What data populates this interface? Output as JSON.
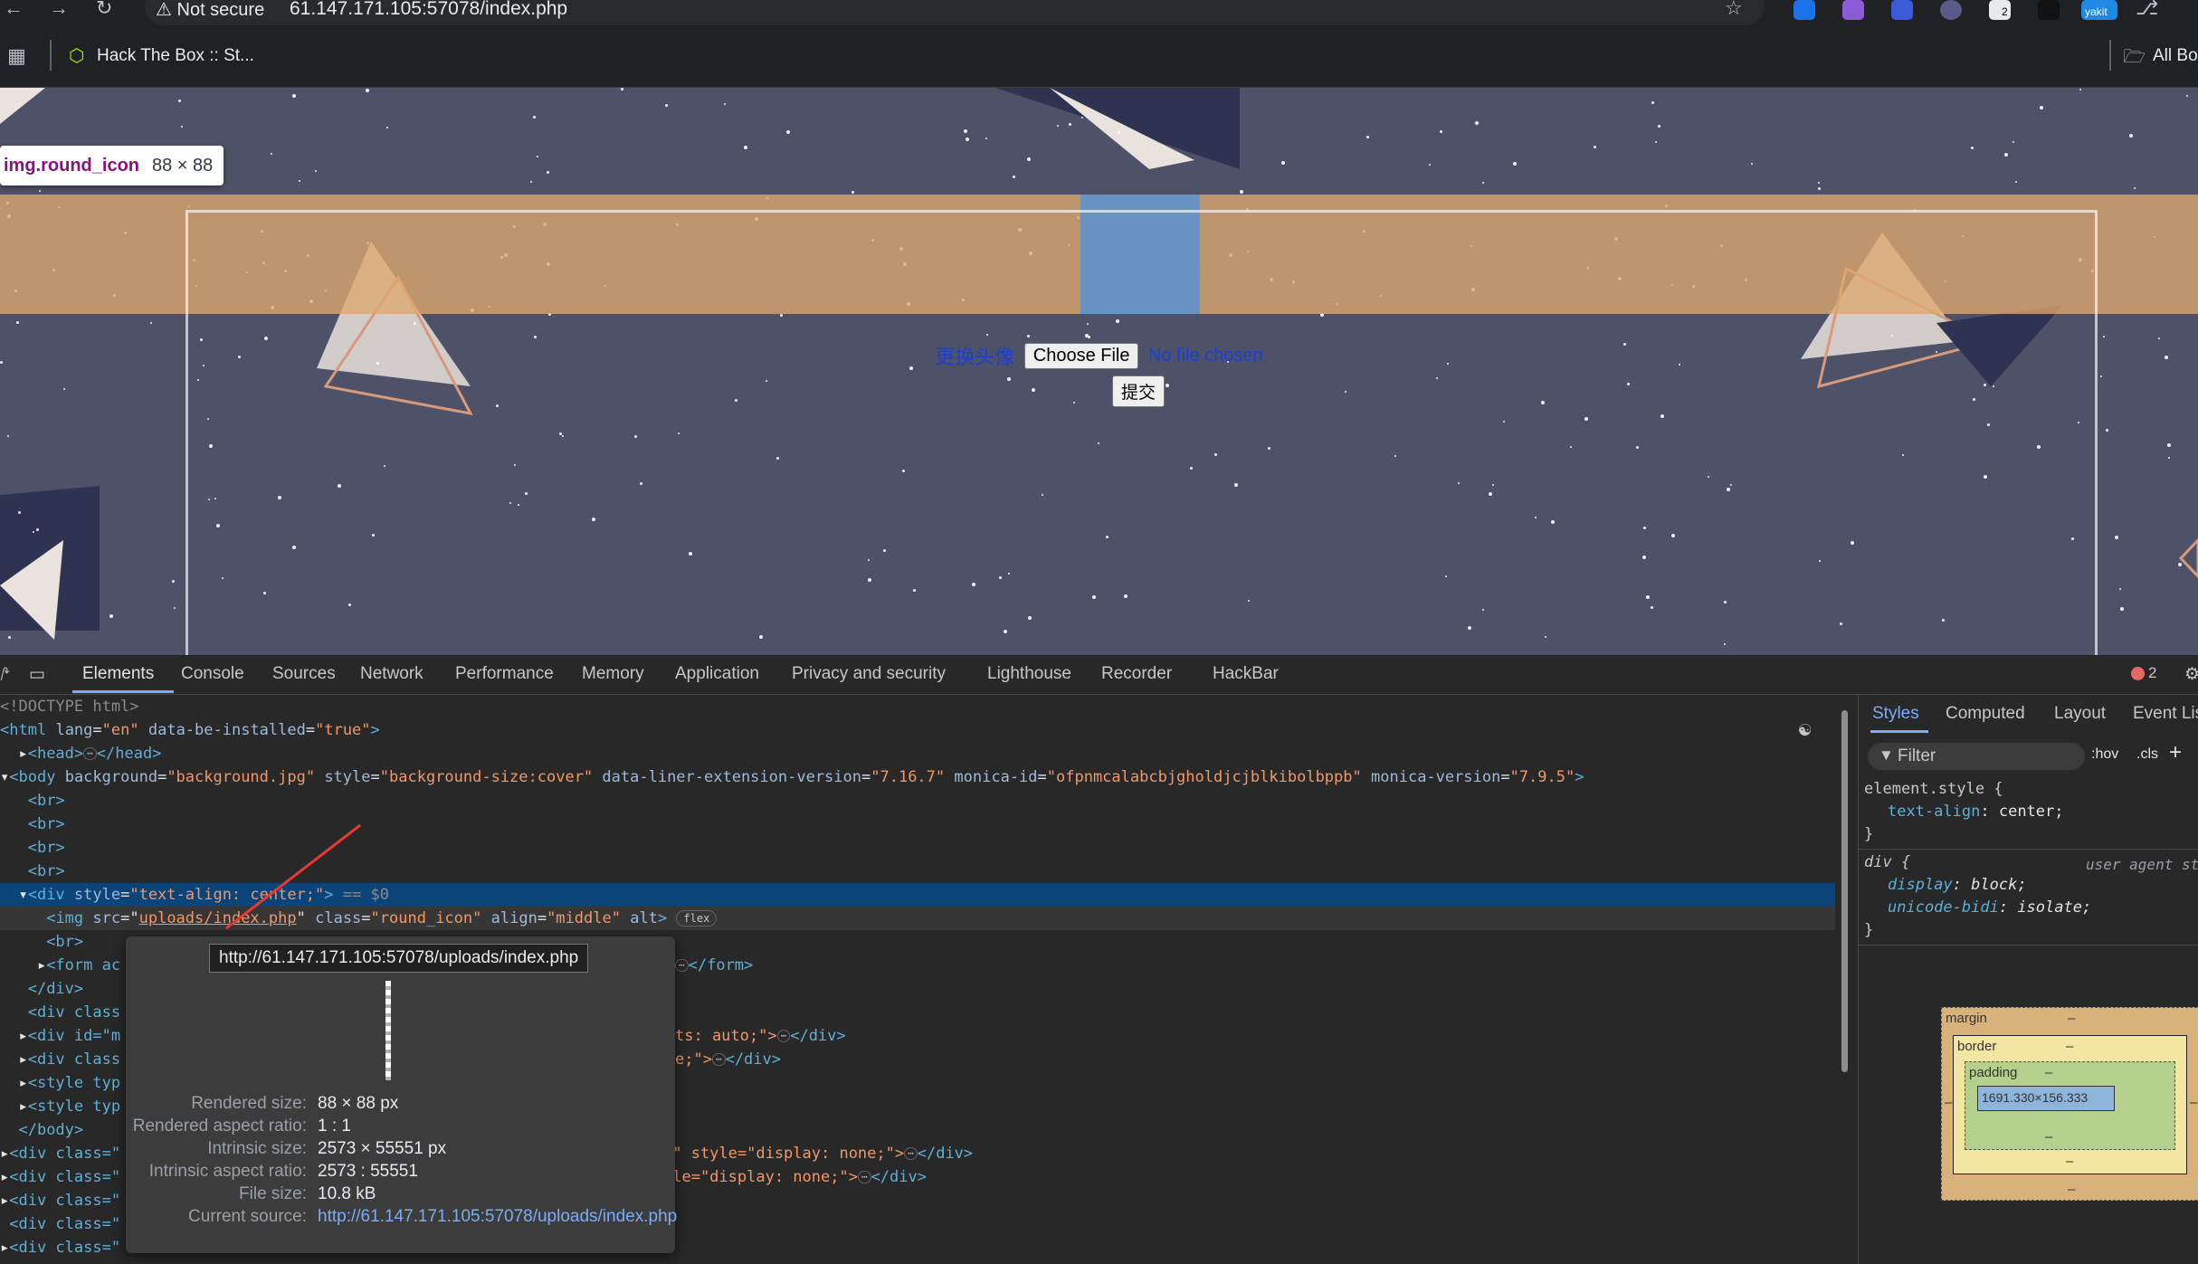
{
  "browser": {
    "security_label": "Not secure",
    "url": "61.147.171.105:57078/index.php",
    "bookmark_label": "Hack The Box :: St...",
    "all_bookmarks_label": "All Bookmarks",
    "extension_badge": "2",
    "extension_label": "yakit"
  },
  "page": {
    "tooltip_selector": "img.round_icon",
    "tooltip_size": "88 × 88",
    "upload_label": "更换头像",
    "choose_file": "Choose File",
    "no_file": "No file chosen",
    "submit": "提交",
    "background_color": "#4d5268"
  },
  "devtools": {
    "tabs": [
      "Elements",
      "Console",
      "Sources",
      "Network",
      "Performance",
      "Memory",
      "Application",
      "Privacy and security",
      "Lighthouse",
      "Recorder",
      "HackBar"
    ],
    "error_count": "2",
    "dom": {
      "doctype": "<!DOCTYPE html>",
      "html_tag": "html",
      "html_attr_lang": "lang",
      "html_val_lang": "\"en\"",
      "html_attr_installed": "data-be-installed",
      "html_val_installed": "\"true\"",
      "head_open": "<head>",
      "head_close": "</head>",
      "body_tag": "body",
      "body_attr_bg": "background",
      "body_val_bg": "\"background.jpg\"",
      "body_attr_style": "style",
      "body_val_style": "\"background-size:cover\"",
      "body_attr_liner": "data-liner-extension-version",
      "body_val_liner": "\"7.16.7\"",
      "body_attr_monica": "monica-id",
      "body_val_monica": "\"ofpnmcalabcbjgholdjcjblkibolbppb\"",
      "body_attr_mver": "monica-version",
      "body_val_mver": "\"7.9.5\"",
      "br": "<br>",
      "div_style_attr": "style",
      "div_style_val": "\"text-align: center;\"",
      "eq_dollar": "== $0",
      "img_tag": "img",
      "img_attr_src": "src",
      "img_val_src": "uploads/index.php",
      "img_attr_class": "class",
      "img_val_class": "\"round_icon\"",
      "img_attr_align": "align",
      "img_val_align": "\"middle\"",
      "img_attr_alt": "alt",
      "flex_badge": "flex",
      "form_partial": "<form ac",
      "form_close": "</form>",
      "div_close": "</div>",
      "div_class_partial": "<div class",
      "div_id_partial": "<div id=\"m",
      "div_class_partial2": "<div class",
      "style_partial": "<style typ",
      "body_close": "</body>",
      "div_class_full_partial": "<div class=\"",
      "auto_tail": "ts: auto;\">",
      "e_tail": "e;\">",
      "p_tail": "p\" style=\"display: none;\">",
      "yle_tail": "yle=\"display: none;\">"
    },
    "image_popup": {
      "url": "http://61.147.171.105:57078/uploads/index.php",
      "rendered_size_label": "Rendered size:",
      "rendered_size": "88 × 88 px",
      "rendered_ratio_label": "Rendered aspect ratio:",
      "rendered_ratio": "1 : 1",
      "intrinsic_size_label": "Intrinsic size:",
      "intrinsic_size": "2573 × 55551 px",
      "intrinsic_ratio_label": "Intrinsic aspect ratio:",
      "intrinsic_ratio": "2573 : 55551",
      "file_size_label": "File size:",
      "file_size": "10.8 kB",
      "current_source_label": "Current source:",
      "current_source": "http://61.147.171.105:57078/uploads/index.php"
    },
    "styles": {
      "tabs": [
        "Styles",
        "Computed",
        "Layout",
        "Event Listeners"
      ],
      "filter_placeholder": "Filter",
      "hov": ":hov",
      "cls": ".cls",
      "element_style_selector": "element.style {",
      "element_style_prop": "text-align",
      "element_style_val": "center;",
      "div_selector": "div {",
      "user_agent_label": "user agent stylesheet",
      "div_prop1": "display",
      "div_val1": "block;",
      "div_prop2": "unicode-bidi",
      "div_val2": "isolate;",
      "close_brace": "}",
      "box_margin": "margin",
      "box_border": "border",
      "box_padding": "padding",
      "box_dash": "–",
      "box_content": "1691.330×156.333"
    }
  }
}
